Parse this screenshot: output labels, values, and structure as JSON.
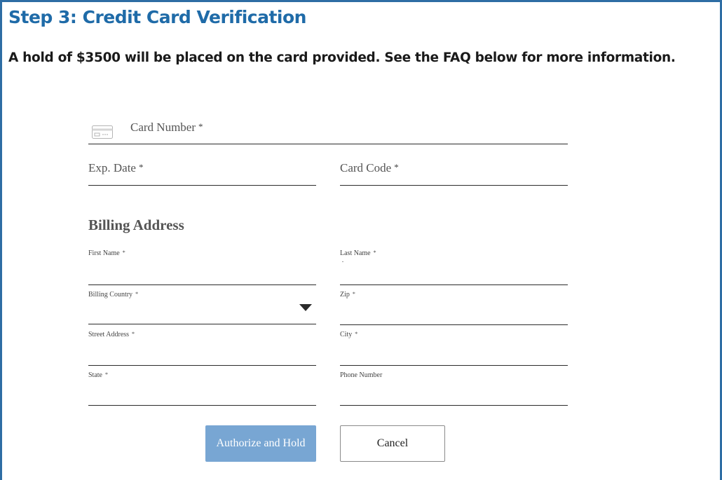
{
  "header": {
    "title": "Step 3: Credit Card Verification",
    "note": "A hold of $3500 will be placed on the card provided. See the FAQ below for more information."
  },
  "icons": {
    "card": "credit-card-icon",
    "dropdown": "caret-down-icon",
    "required": "asterisk"
  },
  "card_fields": {
    "card_number": {
      "label": "Card Number",
      "required_mark": "*",
      "value": ""
    },
    "exp_date": {
      "label": "Exp. Date",
      "required_mark": "*",
      "value": ""
    },
    "card_code": {
      "label": "Card Code",
      "required_mark": "*",
      "value": ""
    }
  },
  "billing": {
    "heading": "Billing Address",
    "first_name": {
      "label": "First Name",
      "required_mark": "*",
      "value": ""
    },
    "last_name": {
      "label": "Last Name",
      "required_mark": "*",
      "value": ""
    },
    "country": {
      "label": "Billing Country",
      "required_mark": "*",
      "value": ""
    },
    "zip": {
      "label": "Zip",
      "required_mark": "*",
      "value": ""
    },
    "street": {
      "label": "Street Address",
      "required_mark": "*",
      "value": ""
    },
    "city": {
      "label": "City",
      "required_mark": "*",
      "value": ""
    },
    "state": {
      "label": "State",
      "required_mark": "*",
      "value": ""
    },
    "phone": {
      "label": "Phone Number",
      "value": ""
    }
  },
  "actions": {
    "authorize_label": "Authorize and Hold",
    "cancel_label": "Cancel"
  },
  "colors": {
    "accent": "#1f6ba8",
    "border": "#2e6da4",
    "primary_button": "#78a6d3",
    "label": "#555555"
  }
}
